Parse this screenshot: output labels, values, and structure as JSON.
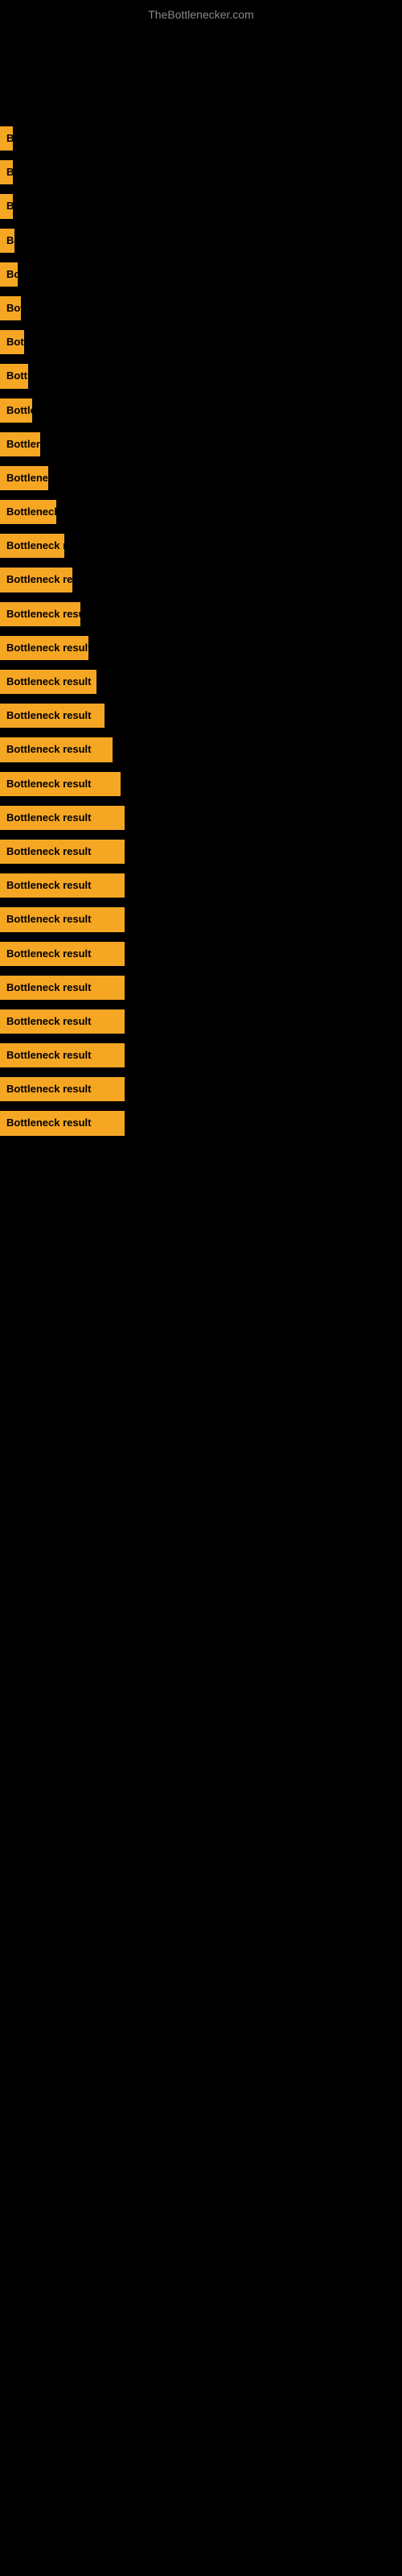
{
  "site": {
    "title": "TheBottlenecker.com"
  },
  "bars": [
    {
      "label": "Bottleneck result",
      "width": 10
    },
    {
      "label": "Bottleneck result",
      "width": 12
    },
    {
      "label": "Bottleneck result",
      "width": 15
    },
    {
      "label": "Bottleneck result",
      "width": 18
    },
    {
      "label": "Bottleneck result",
      "width": 22
    },
    {
      "label": "Bottleneck result",
      "width": 26
    },
    {
      "label": "Bottleneck result",
      "width": 30
    },
    {
      "label": "Bottleneck result",
      "width": 35
    },
    {
      "label": "Bottleneck result",
      "width": 40
    },
    {
      "label": "Bottleneck result",
      "width": 50
    },
    {
      "label": "Bottleneck result",
      "width": 60
    },
    {
      "label": "Bottleneck result",
      "width": 70
    },
    {
      "label": "Bottleneck result",
      "width": 80
    },
    {
      "label": "Bottleneck result",
      "width": 90
    },
    {
      "label": "Bottleneck result",
      "width": 100
    },
    {
      "label": "Bottleneck result",
      "width": 110
    },
    {
      "label": "Bottleneck result",
      "width": 120
    },
    {
      "label": "Bottleneck result",
      "width": 130
    },
    {
      "label": "Bottleneck result",
      "width": 140
    },
    {
      "label": "Bottleneck result",
      "width": 150
    },
    {
      "label": "Bottleneck result",
      "width": 155
    },
    {
      "label": "Bottleneck result",
      "width": 155
    },
    {
      "label": "Bottleneck result",
      "width": 155
    },
    {
      "label": "Bottleneck result",
      "width": 155
    },
    {
      "label": "Bottleneck result",
      "width": 155
    },
    {
      "label": "Bottleneck result",
      "width": 155
    },
    {
      "label": "Bottleneck result",
      "width": 155
    },
    {
      "label": "Bottleneck result",
      "width": 155
    },
    {
      "label": "Bottleneck result",
      "width": 155
    },
    {
      "label": "Bottleneck result",
      "width": 155
    }
  ]
}
